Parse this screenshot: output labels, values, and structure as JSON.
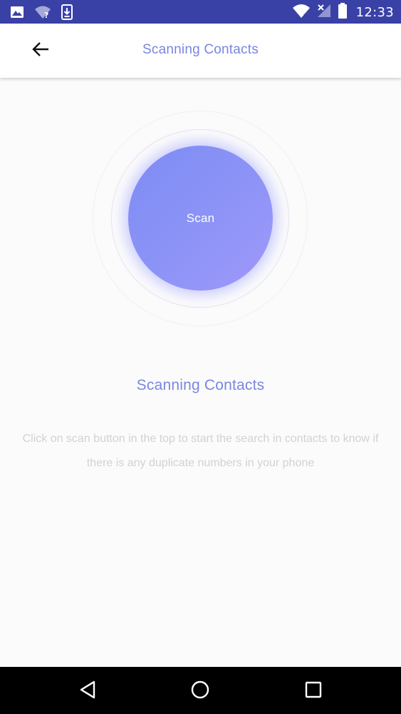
{
  "status_bar": {
    "time": "12:33",
    "left_icons": [
      "image-icon",
      "wifi-question-icon",
      "download-icon"
    ],
    "right_icons": [
      "wifi-icon",
      "no-signal-icon",
      "battery-icon"
    ]
  },
  "app_bar": {
    "title": "Scanning Contacts",
    "back_icon": "arrow-left-icon"
  },
  "scan": {
    "button_label": "Scan"
  },
  "content": {
    "title": "Scanning Contacts",
    "description": "Click on scan button in the top to start the search in contacts to know if there is any duplicate numbers in your phone"
  },
  "nav_bar": {
    "icons": [
      "back-triangle-icon",
      "home-circle-icon",
      "recents-square-icon"
    ]
  },
  "colors": {
    "status_bar": "#3a41a6",
    "accent": "#7b86e0",
    "scan_gradient_start": "#7e8cf4",
    "scan_gradient_end": "#a198fb",
    "description_text": "#d2d2d6"
  }
}
